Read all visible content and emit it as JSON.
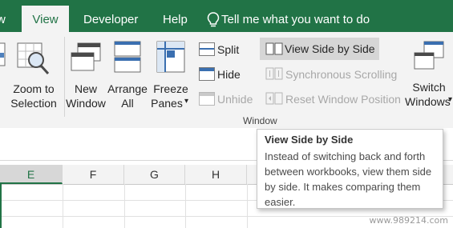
{
  "tabs": {
    "view": "View",
    "developer": "Developer",
    "help": "Help"
  },
  "tell_me": {
    "placeholder": "Tell me what you want to do"
  },
  "ribbon": {
    "zoom_to_selection": {
      "line1": "Zoom to",
      "line2": "Selection"
    },
    "new_window": {
      "line1": "New",
      "line2": "Window"
    },
    "arrange_all": {
      "line1": "Arrange",
      "line2": "All"
    },
    "freeze_panes": {
      "line1": "Freeze",
      "line2": "Panes"
    },
    "split": "Split",
    "hide": "Hide",
    "unhide": "Unhide",
    "view_side_by_side": "View Side by Side",
    "synchronous_scrolling": "Synchronous Scrolling",
    "reset_window_position": "Reset Window Position",
    "switch_windows": {
      "line1": "Switch",
      "line2": "Windows"
    },
    "group_label": "Window"
  },
  "columns": [
    "E",
    "F",
    "G",
    "H"
  ],
  "tooltip": {
    "title": "View Side by Side",
    "body": "Instead of switching back and forth between workbooks, view them side by side. It makes comparing them easier."
  },
  "watermark": "www.989214.com",
  "colors": {
    "accent": "#217346",
    "ribbon_bg": "#f3f3f3",
    "disabled": "#a8a8a8"
  }
}
